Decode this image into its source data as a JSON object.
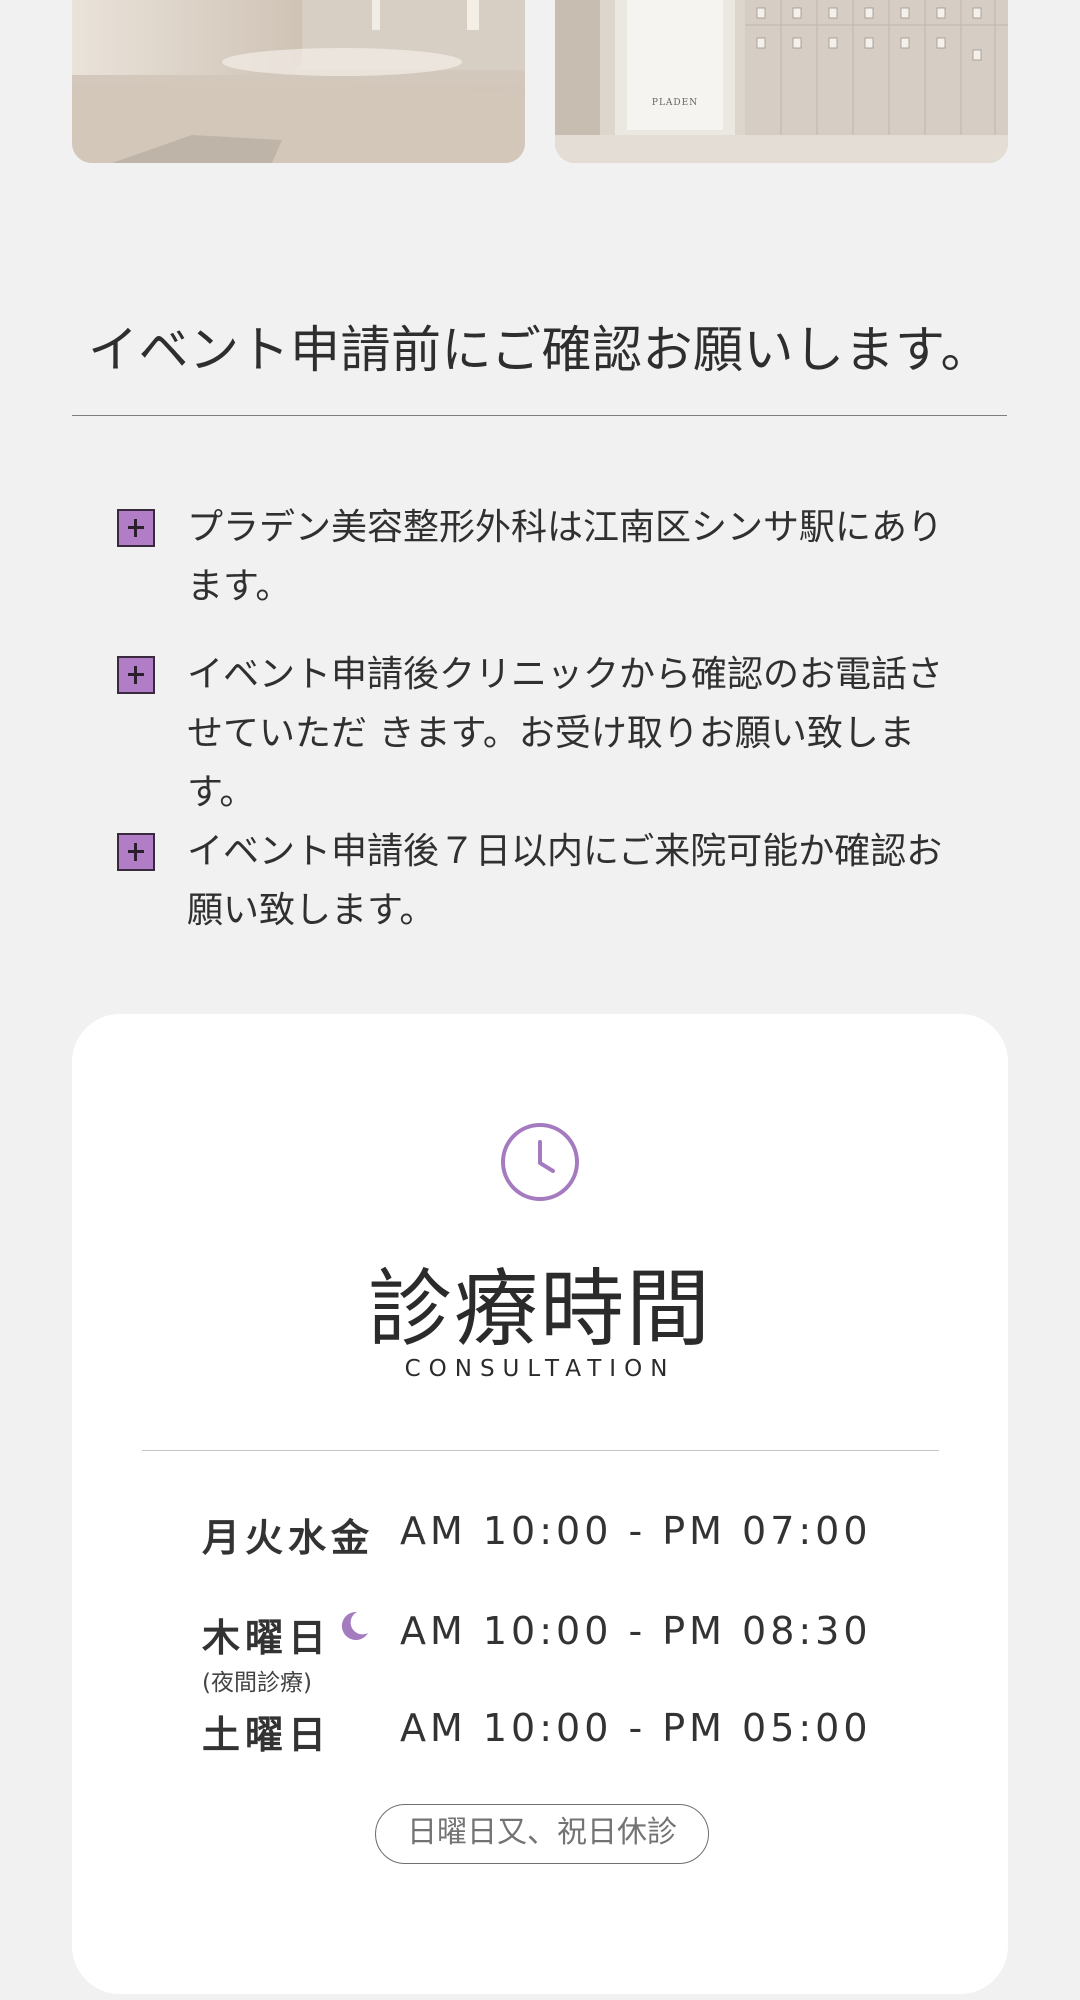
{
  "gallery": {
    "images": [
      {
        "name": "clinic-lobby-photo"
      },
      {
        "name": "clinic-locker-room-photo",
        "sign_text": "PLADEN"
      }
    ]
  },
  "notice": {
    "title": "イベント申請前にご確認お願いします。",
    "items": [
      {
        "icon": "plus-box-icon",
        "text": "プラデン美容整形外科は江南区シンサ駅にあります。"
      },
      {
        "icon": "plus-box-icon",
        "text": "イベント申請後クリニックから確認のお電話させていただ きます。お受け取りお願い致します。"
      },
      {
        "icon": "plus-box-icon",
        "text": "イベント申請後７日以内にご来院可能か確認お願い致します。"
      }
    ]
  },
  "hours": {
    "icon": "clock-icon",
    "title": "診療時間",
    "subtitle": "CONSULTATION",
    "rows": [
      {
        "day": "月火水金",
        "time": "AM 10:00 - PM 07:00"
      },
      {
        "day": "木曜日",
        "icon": "moon-icon",
        "note": "(夜間診療)",
        "time": "AM 10:00 - PM 08:30"
      },
      {
        "day": "土曜日",
        "time": "AM 10:00 - PM 05:00"
      }
    ],
    "closed": "日曜日又、祝日休診"
  },
  "colors": {
    "background": "#f1f1f1",
    "card": "#ffffff",
    "accent_purple": "#a57bbf",
    "plus_box": "#b07dc6",
    "text": "#2e2e2e"
  }
}
